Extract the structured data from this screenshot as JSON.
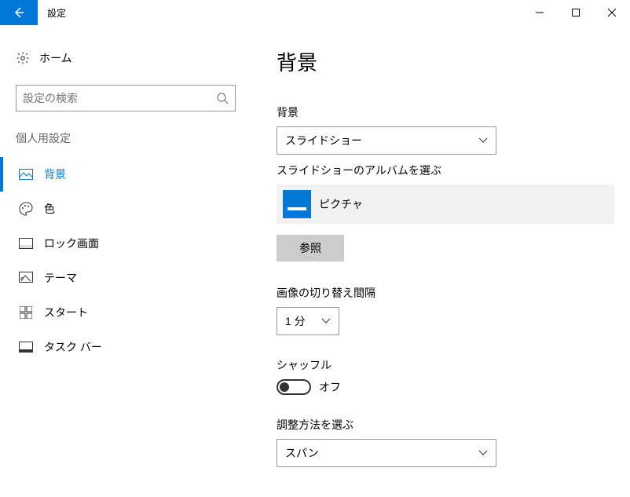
{
  "titlebar": {
    "title": "設定"
  },
  "sidebar": {
    "home": "ホーム",
    "search_placeholder": "設定の検索",
    "section_heading": "個人用設定",
    "items": [
      {
        "label": "背景"
      },
      {
        "label": "色"
      },
      {
        "label": "ロック画面"
      },
      {
        "label": "テーマ"
      },
      {
        "label": "スタート"
      },
      {
        "label": "タスク バー"
      }
    ]
  },
  "main": {
    "page_title": "背景",
    "background_label": "背景",
    "background_value": "スライドショー",
    "album_label": "スライドショーのアルバムを選ぶ",
    "album_name": "ピクチャ",
    "browse_label": "参照",
    "interval_label": "画像の切り替え間隔",
    "interval_value": "1 分",
    "shuffle_label": "シャッフル",
    "shuffle_state": "オフ",
    "fit_label": "調整方法を選ぶ",
    "fit_value": "スパン"
  }
}
